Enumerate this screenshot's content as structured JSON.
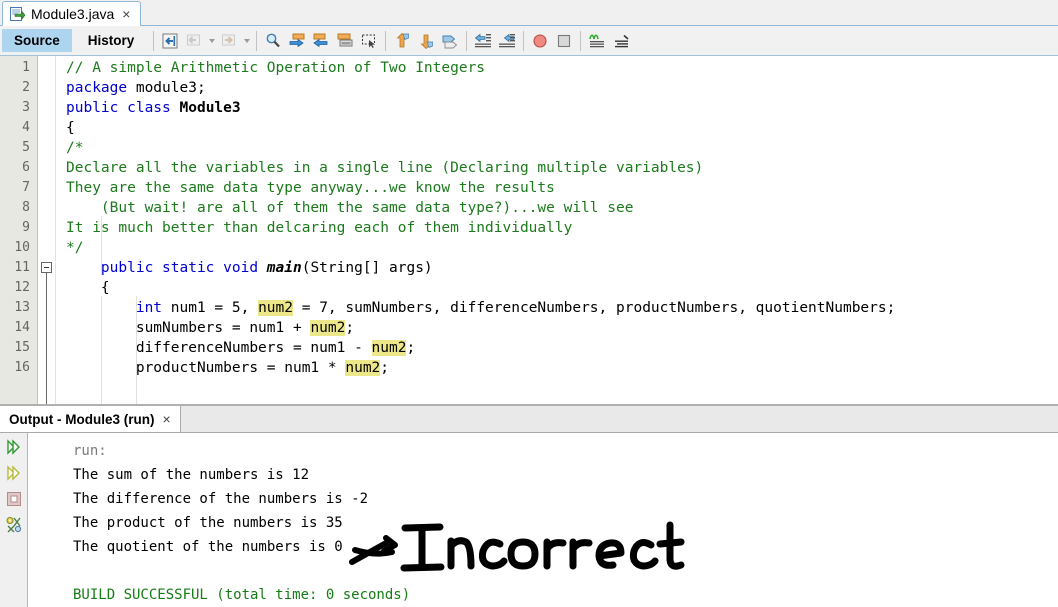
{
  "window": {
    "file_tab": {
      "label": "Module3.java",
      "close_label": "×",
      "icon": "java-file-icon"
    }
  },
  "toolbar": {
    "view_tabs": [
      {
        "label": "Source",
        "active": true
      },
      {
        "label": "History",
        "active": false
      }
    ],
    "buttons": [
      {
        "name": "last-edit-icon",
        "icon": "last-edit"
      },
      {
        "name": "back-icon",
        "icon": "back"
      },
      {
        "name": "back-dropdown-icon",
        "icon": "caret-down"
      },
      {
        "name": "forward-icon",
        "icon": "forward"
      },
      {
        "name": "forward-dropdown-icon",
        "icon": "caret-down"
      },
      {
        "name": "find-selection-icon",
        "icon": "magnifier"
      },
      {
        "name": "find-previous-icon",
        "icon": "arrow-left-box"
      },
      {
        "name": "find-next-icon",
        "icon": "arrow-right-box"
      },
      {
        "name": "toggle-highlight-icon",
        "icon": "stacked-box"
      },
      {
        "name": "toggle-rectangular-selection-icon",
        "icon": "dotted-select"
      },
      {
        "name": "previous-bookmark-icon",
        "icon": "arrow-up-tag"
      },
      {
        "name": "next-bookmark-icon",
        "icon": "arrow-down-tag"
      },
      {
        "name": "toggle-bookmark-icon",
        "icon": "tag"
      },
      {
        "name": "shift-line-left-icon",
        "icon": "shift-left"
      },
      {
        "name": "shift-line-right-icon",
        "icon": "shift-right"
      },
      {
        "name": "toggle-breakpoint-icon",
        "icon": "red-circle"
      },
      {
        "name": "stop-icon",
        "icon": "grey-square"
      },
      {
        "name": "inspect-icon",
        "icon": "green-squiggle"
      },
      {
        "name": "comment-icon",
        "icon": "lines"
      }
    ]
  },
  "editor": {
    "line_numbers": [
      1,
      2,
      3,
      4,
      5,
      6,
      7,
      8,
      9,
      10,
      11,
      12,
      13,
      14,
      15,
      16
    ],
    "fold_marker_line": 12,
    "lines": [
      {
        "n": 1,
        "segments": [
          {
            "t": "// A simple Arithmetic Operation of Two Integers",
            "c": "c-com"
          }
        ]
      },
      {
        "n": 2,
        "segments": [
          {
            "t": "package",
            "c": "c-kw"
          },
          {
            "t": " module3;",
            "c": "c-pln"
          }
        ]
      },
      {
        "n": 3,
        "segments": [
          {
            "t": "public class ",
            "c": "c-kw"
          },
          {
            "t": "Module3",
            "c": "c-cls"
          }
        ]
      },
      {
        "n": 4,
        "segments": [
          {
            "t": "{",
            "c": "c-pln"
          }
        ]
      },
      {
        "n": 5,
        "segments": [
          {
            "t": "/*",
            "c": "c-com"
          }
        ]
      },
      {
        "n": 6,
        "segments": [
          {
            "t": "Declare all the variables in a single line (Declaring multiple variables)",
            "c": "c-com"
          }
        ]
      },
      {
        "n": 7,
        "segments": [
          {
            "t": "They are the same data type anyway...we know the results",
            "c": "c-com"
          }
        ]
      },
      {
        "n": 8,
        "segments": [
          {
            "t": "    (But wait! are all of them the same data type?)...we will see",
            "c": "c-com"
          }
        ]
      },
      {
        "n": 9,
        "segments": [
          {
            "t": "It is much better than delcaring each of them individually",
            "c": "c-com"
          }
        ]
      },
      {
        "n": 10,
        "segments": [
          {
            "t": "*/",
            "c": "c-com"
          }
        ]
      },
      {
        "n": 11,
        "segments": [
          {
            "t": "    ",
            "c": "c-pln"
          },
          {
            "t": "public static void ",
            "c": "c-kw"
          },
          {
            "t": "main",
            "c": "c-mth"
          },
          {
            "t": "(String[] args)",
            "c": "c-pln"
          }
        ]
      },
      {
        "n": 12,
        "segments": [
          {
            "t": "    {",
            "c": "c-pln"
          }
        ]
      },
      {
        "n": 13,
        "segments": [
          {
            "t": "        ",
            "c": "c-pln"
          },
          {
            "t": "int",
            "c": "c-kw"
          },
          {
            "t": " num1 = 5, ",
            "c": "c-pln"
          },
          {
            "t": "num2",
            "c": "c-pln hl"
          },
          {
            "t": " = 7, sumNumbers, differenceNumbers, productNumbers, quotientNumbers;",
            "c": "c-pln"
          }
        ]
      },
      {
        "n": 14,
        "segments": [
          {
            "t": "        sumNumbers = num1 + ",
            "c": "c-pln"
          },
          {
            "t": "num2",
            "c": "c-pln hl"
          },
          {
            "t": ";",
            "c": "c-pln"
          }
        ]
      },
      {
        "n": 15,
        "segments": [
          {
            "t": "        differenceNumbers = num1 - ",
            "c": "c-pln"
          },
          {
            "t": "num2",
            "c": "c-pln hl"
          },
          {
            "t": ";",
            "c": "c-pln"
          }
        ]
      },
      {
        "n": 16,
        "segments": [
          {
            "t": "        productNumbers = num1 * ",
            "c": "c-pln"
          },
          {
            "t": "num2",
            "c": "c-pln hl"
          },
          {
            "t": ";",
            "c": "c-pln"
          }
        ]
      }
    ]
  },
  "output": {
    "tab": {
      "label": "Output - Module3 (run)",
      "close_label": "×"
    },
    "sidebar_buttons": [
      {
        "name": "rerun-icon",
        "icon": "green-double-arrow"
      },
      {
        "name": "rerun-alt-icon",
        "icon": "olive-double-arrow"
      },
      {
        "name": "stop-process-icon",
        "icon": "stop-square"
      },
      {
        "name": "clear-output-icon",
        "icon": "gear-scissors"
      }
    ],
    "lines": [
      {
        "text": "run:",
        "c": "o-grey"
      },
      {
        "text": "The sum of the numbers is 12",
        "c": "o-blk"
      },
      {
        "text": "The difference of the numbers is -2",
        "c": "o-blk"
      },
      {
        "text": "The product of the numbers is 35",
        "c": "o-blk"
      },
      {
        "text": "The quotient of the numbers is 0",
        "c": "o-blk"
      },
      {
        "text": "",
        "c": "o-blk"
      },
      {
        "text": "BUILD SUCCESSFUL (total time: 0 seconds)",
        "c": "o-grn"
      }
    ]
  },
  "annotation": {
    "text": "Incorrect",
    "marker": "arrow-pointing-to-quotient-value"
  },
  "colors": {
    "accent": "#aed5ef",
    "tab_border": "#8fb8d8",
    "highlight": "#ece88a",
    "comment": "#1d7a1d",
    "keyword": "#0000d0",
    "build_success": "#157d15"
  }
}
